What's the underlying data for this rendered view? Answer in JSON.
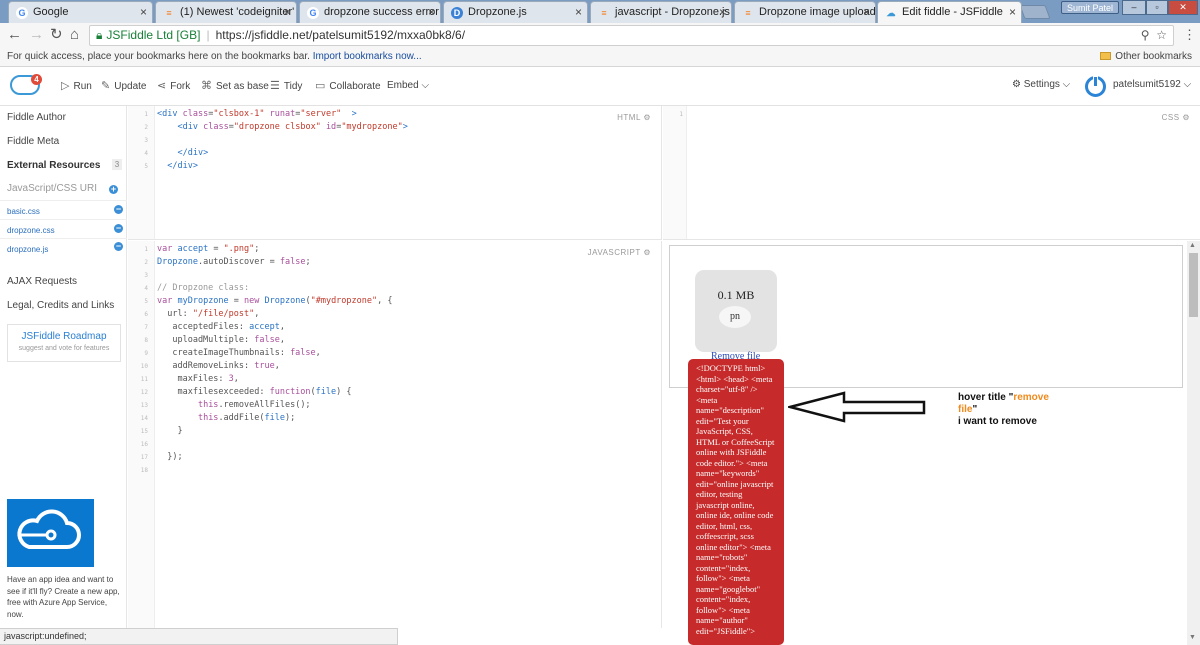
{
  "browser": {
    "tabs": [
      {
        "title": "Google",
        "icon": "google-icon",
        "icon_color": "#4285f4"
      },
      {
        "title": "(1) Newest 'codeigniter' Q",
        "icon": "stackoverflow-icon",
        "icon_color": "#f48024"
      },
      {
        "title": "dropzone success error m",
        "icon": "google-icon",
        "icon_color": "#4285f4"
      },
      {
        "title": "Dropzone.js",
        "icon": "dropzone-icon",
        "icon_color": "#3b82d6"
      },
      {
        "title": "javascript - Dropzone.js",
        "icon": "stackoverflow-icon",
        "icon_color": "#f48024"
      },
      {
        "title": "Dropzone image upload",
        "icon": "stackoverflow-icon",
        "icon_color": "#f48024"
      },
      {
        "title": "Edit fiddle - JSFiddle",
        "icon": "jsfiddle-icon",
        "icon_color": "#3b99d8"
      }
    ],
    "profile": "Sumit Patel",
    "site_name": "JSFiddle Ltd [GB]",
    "url": "https://jsfiddle.net/patelsumit5192/mxxa0bk8/6/",
    "bookmarks_hint": "For quick access, place your bookmarks here on the bookmarks bar.",
    "bookmarks_import": "Import bookmarks now...",
    "other_bookmarks": "Other bookmarks",
    "status": "javascript:undefined;"
  },
  "fiddle_header": {
    "logo_badge": "4",
    "run": "Run",
    "update": "Update",
    "fork": "Fork",
    "set_base": "Set as base",
    "tidy": "Tidy",
    "collaborate": "Collaborate",
    "embed": "Embed",
    "settings": "Settings",
    "username": "patelsumit5192"
  },
  "sidebar": {
    "fiddle_author": "Fiddle Author",
    "fiddle_meta": "Fiddle Meta",
    "external_resources": "External Resources",
    "resource_count": "3",
    "uri_placeholder": "JavaScript/CSS URI",
    "resources": [
      "basic.css",
      "dropzone.css",
      "dropzone.js"
    ],
    "ajax": "AJAX Requests",
    "legal": "Legal, Credits and Links",
    "roadmap_title": "JSFiddle Roadmap",
    "roadmap_sub": "suggest and vote for features",
    "ad_text": "Have an app idea and want to see if it'll fly? Create a new app, free with Azure App Service, now."
  },
  "panels": {
    "html_label": "HTML",
    "css_label": "CSS",
    "js_label": "JAVASCRIPT"
  },
  "result": {
    "file_size": "0.1 MB",
    "file_name": "pn",
    "remove_link": "Remove file",
    "tooltip": "<!DOCTYPE html> <html> <head> <meta charset=\"utf-8\" /> <meta name=\"description\" edit=\"Test your JavaScript, CSS, HTML or CoffeeScript online with JSFiddle code editor.\"> <meta name=\"keywords\" edit=\"online javascript editor, testing javascript online, online ide, online code editor, html, css, coffeescript, scss online editor\"> <meta name=\"robots\" content=\"index, follow\"> <meta name=\"googlebot\" content=\"index, follow\"> <meta name=\"author\" edit=\"JSFiddle\">"
  },
  "annotation": {
    "line1_prefix": "hover title \"",
    "line1_highlight": "remove",
    "line2_highlight": "file",
    "line2_suffix": "\"",
    "line3": "i want to remove"
  }
}
